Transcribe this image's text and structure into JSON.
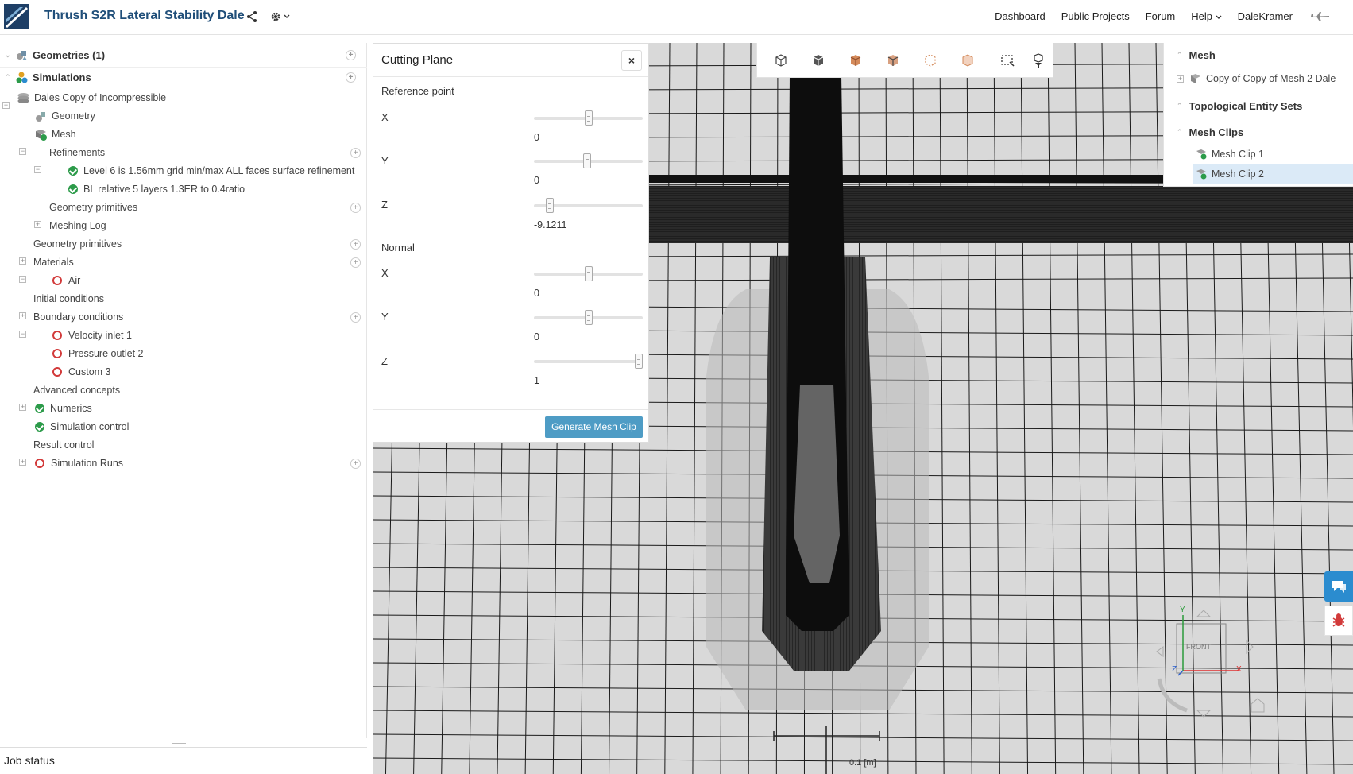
{
  "app": {
    "project_title": "Thrush S2R Lateral Stability Dale",
    "nav": [
      "Dashboard",
      "Public Projects",
      "Forum",
      "Help",
      "DaleKramer"
    ]
  },
  "tree": {
    "geometries": "Geometries (1)",
    "simulations": "Simulations",
    "sim_name": "Dales Copy of Incompressible",
    "geometry": "Geometry",
    "mesh": "Mesh",
    "refinements": "Refinements",
    "ref1": "Level 6 is 1.56mm grid min/max ALL faces surface refinement",
    "ref2": "BL relative 5 layers 1.3ER to 0.4ratio",
    "geom_prims_mesh": "Geometry primitives",
    "meshing_log": "Meshing Log",
    "geom_prims": "Geometry primitives",
    "materials": "Materials",
    "air": "Air",
    "initial_conditions": "Initial conditions",
    "boundary_conditions": "Boundary conditions",
    "bc1": "Velocity inlet 1",
    "bc2": "Pressure outlet 2",
    "bc3": "Custom 3",
    "advanced": "Advanced concepts",
    "numerics": "Numerics",
    "sim_control": "Simulation control",
    "result_control": "Result control",
    "sim_runs": "Simulation Runs"
  },
  "job_status": "Job status",
  "cutting_plane": {
    "title": "Cutting Plane",
    "close": "×",
    "reference_point": "Reference point",
    "normal": "Normal",
    "ref": {
      "x_label": "X",
      "x_value": "0",
      "x_level": 0.5,
      "y_label": "Y",
      "y_value": "0",
      "y_level": 0.49,
      "z_label": "Z",
      "z_value": "-9.1211",
      "z_level": 0.12
    },
    "norm": {
      "x_label": "X",
      "x_value": "0",
      "x_level": 0.5,
      "y_label": "Y",
      "y_value": "0",
      "y_level": 0.5,
      "z_label": "Z",
      "z_value": "1",
      "z_level": 1.0
    },
    "generate_button": "Generate Mesh Clip"
  },
  "right_panel": {
    "mesh": "Mesh",
    "mesh_item": "Copy of Copy of Mesh 2 Dale",
    "topo": "Topological Entity Sets",
    "clips": "Mesh Clips",
    "clip1": "Mesh Clip 1",
    "clip2": "Mesh Clip 2"
  },
  "viewport": {
    "orientation_label": "FRONT",
    "scale_label": "0.1 [m]",
    "axis_x": "X",
    "axis_y": "Y",
    "axis_z": "Z"
  },
  "colors": {
    "accent": "#1f4e79",
    "button": "#4e9cc5",
    "ok": "#2c9b4a",
    "error": "#d23a3a",
    "selected": "#dbeaf7"
  }
}
